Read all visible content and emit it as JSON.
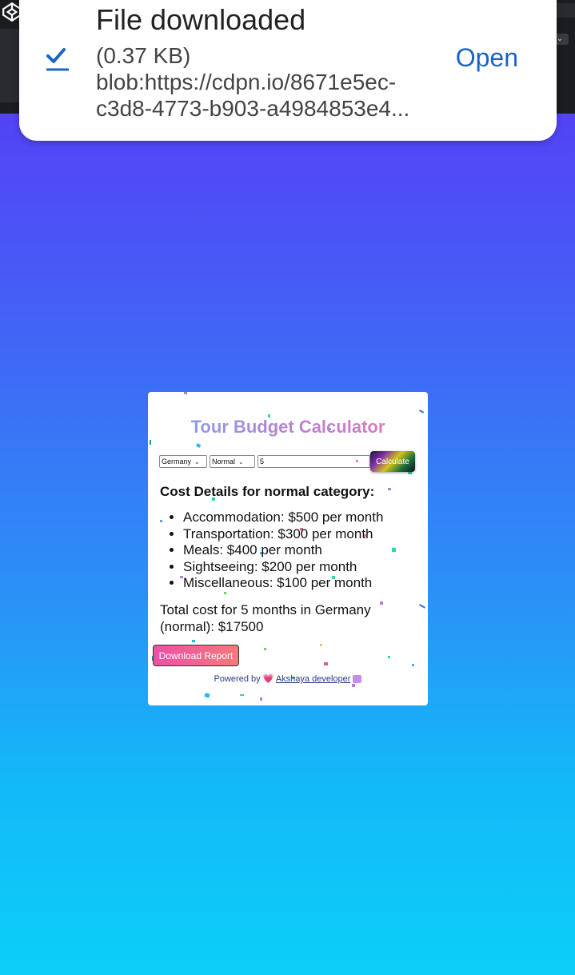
{
  "notification": {
    "title": "File downloaded",
    "size": "(0.37 KB)",
    "url": "blob:https://cdpn.io/8671e5ec-c3d8-4773-b903-a4984853e4...",
    "open_label": "Open"
  },
  "calculator": {
    "title": "Tour Budget Calculator",
    "country_value": "Germany",
    "category_value": "Normal",
    "months_value": "5",
    "calculate_label": "Calculate",
    "details_heading": "Cost Details for normal category:",
    "costs": [
      "Accommodation: $500 per month",
      "Transportation: $300 per month",
      "Meals: $400 per month",
      "Sightseeing: $200 per month",
      "Miscellaneous: $100 per month"
    ],
    "total_text": "Total cost for 5 months in Germany (normal): $17500",
    "download_label": "Download Report",
    "powered_prefix": "Powered by",
    "powered_link": "Akshaya developer"
  },
  "colors": {
    "open_link": "#1a63c8",
    "bg_top": "#5a33f4",
    "bg_bottom": "#0ccff9"
  }
}
